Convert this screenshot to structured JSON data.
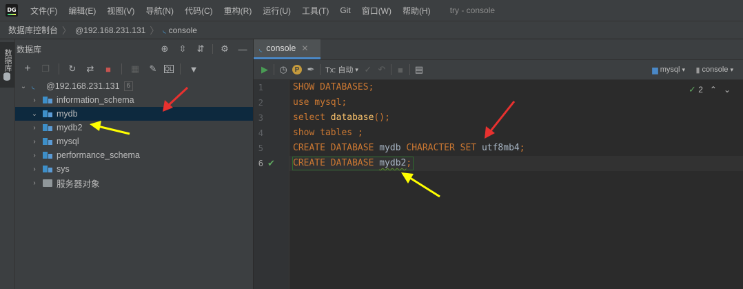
{
  "app": {
    "logo": "DG",
    "window_title": "try - console",
    "menu": [
      "文件(F)",
      "编辑(E)",
      "视图(V)",
      "导航(N)",
      "代码(C)",
      "重构(R)",
      "运行(U)",
      "工具(T)",
      "Git",
      "窗口(W)",
      "帮助(H)"
    ]
  },
  "breadcrumb": [
    "数据库控制台",
    "@192.168.231.131",
    "console"
  ],
  "side_stripe": {
    "tab_label": "数据库"
  },
  "db_panel": {
    "title": "数据库",
    "tree": {
      "root": {
        "label": "@192.168.231.131",
        "badge": "6"
      },
      "items": [
        {
          "label": "information_schema",
          "type": "schema",
          "expanded": false
        },
        {
          "label": "mydb",
          "type": "schema",
          "expanded": true,
          "selected": true
        },
        {
          "label": "mydb2",
          "type": "schema",
          "expanded": false
        },
        {
          "label": "mysql",
          "type": "schema",
          "expanded": false
        },
        {
          "label": "performance_schema",
          "type": "schema",
          "expanded": false
        },
        {
          "label": "sys",
          "type": "schema",
          "expanded": false
        },
        {
          "label": "服务器对象",
          "type": "folder",
          "expanded": false
        }
      ]
    }
  },
  "editor": {
    "tab_label": "console",
    "tx_label": "Tx: 自动",
    "datasource": "mysql",
    "session": "console",
    "inspection_count": "2",
    "line_numbers": [
      "1",
      "2",
      "3",
      "4",
      "5",
      "6"
    ],
    "lines": [
      {
        "kw1": "SHOW DATABASES",
        "rest": ";"
      },
      {
        "kw1": "use",
        "rest": " mysql;"
      },
      {
        "kw1": "select",
        "fn": "database",
        "rest": "();"
      },
      {
        "kw1": "show tables",
        "rest": " ;"
      },
      {
        "kw1": "CREATE DATABASE",
        "id1": " mydb ",
        "kw2": "CHARACTER SET",
        "id2": " utf8mb4",
        "rest": ";"
      },
      {
        "kw1": "CREATE DATABASE",
        "id1": "mydb2",
        "rest": ";"
      }
    ]
  },
  "colors": {
    "annotation_red": "#e8312f",
    "annotation_yellow": "#ffff00",
    "keyword": "#cc7832",
    "identifier": "#a9b7c6",
    "function": "#ffc66d",
    "selection": "#0d293e"
  }
}
